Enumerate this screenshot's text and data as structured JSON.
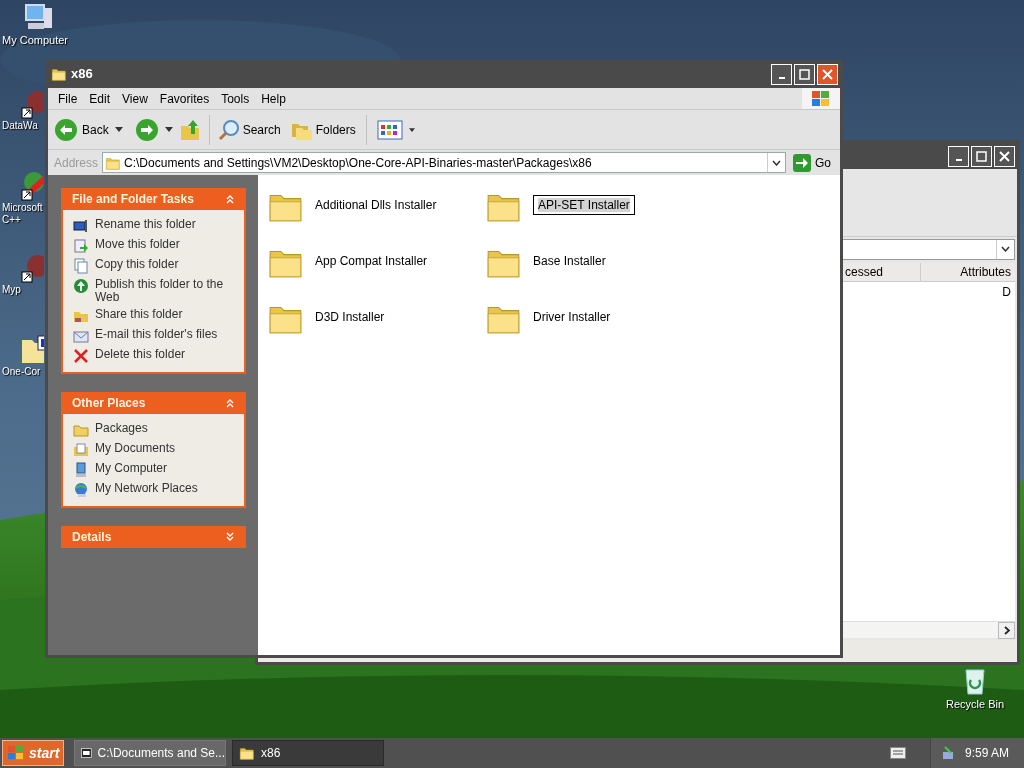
{
  "desktop_icons": [
    {
      "label": "My Computer",
      "kind": "computer"
    },
    {
      "label": "DataWa",
      "kind": "app"
    },
    {
      "label": "Microsoft C++",
      "kind": "tool"
    },
    {
      "label": "Myp",
      "kind": "app"
    },
    {
      "label": "One-Cor",
      "kind": "document"
    }
  ],
  "recycle_bin": {
    "label": "Recycle Bin"
  },
  "back_window": {
    "columns": [
      "cessed",
      "Attributes"
    ],
    "cell": "D"
  },
  "window": {
    "title": "x86",
    "menu": [
      "File",
      "Edit",
      "View",
      "Favorites",
      "Tools",
      "Help"
    ],
    "toolbar": {
      "back": "Back",
      "search": "Search",
      "folders": "Folders"
    },
    "address": {
      "label": "Address",
      "value": "C:\\Documents and Settings\\VM2\\Desktop\\One-Core-API-Binaries-master\\Packages\\x86",
      "go": "Go"
    },
    "task_panels": [
      {
        "title": "File and Folder Tasks",
        "expanded": true,
        "items": [
          {
            "label": "Rename this folder",
            "kind": "rename"
          },
          {
            "label": "Move this folder",
            "kind": "move"
          },
          {
            "label": "Copy this folder",
            "kind": "copy"
          },
          {
            "label": "Publish this folder to the Web",
            "kind": "publish"
          },
          {
            "label": "Share this folder",
            "kind": "share"
          },
          {
            "label": "E-mail this folder's files",
            "kind": "email"
          },
          {
            "label": "Delete this folder",
            "kind": "delete"
          }
        ]
      },
      {
        "title": "Other Places",
        "expanded": true,
        "items": [
          {
            "label": "Packages",
            "kind": "folder"
          },
          {
            "label": "My Documents",
            "kind": "documents"
          },
          {
            "label": "My Computer",
            "kind": "computer"
          },
          {
            "label": "My Network Places",
            "kind": "network"
          }
        ]
      },
      {
        "title": "Details",
        "expanded": false
      }
    ],
    "folders": [
      {
        "name": "Additional Dlls Installer",
        "selected": false
      },
      {
        "name": "API-SET Installer",
        "selected": true
      },
      {
        "name": "App Compat Installer",
        "selected": false
      },
      {
        "name": "Base Installer",
        "selected": false
      },
      {
        "name": "D3D Installer",
        "selected": false
      },
      {
        "name": "Driver Installer",
        "selected": false
      }
    ]
  },
  "taskbar": {
    "start": "start",
    "tasks": [
      {
        "label": "C:\\Documents and Se...",
        "kind": "archive",
        "selected": false
      },
      {
        "label": "x86",
        "kind": "folder",
        "selected": true
      }
    ],
    "clock": "9:59 AM"
  }
}
